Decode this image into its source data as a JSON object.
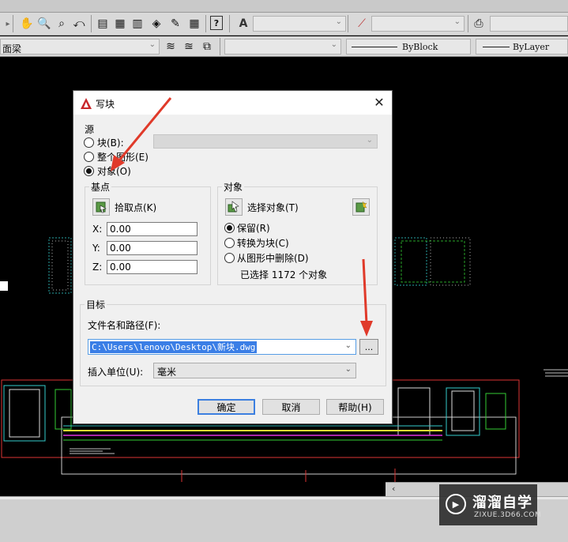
{
  "toolbar": {
    "layer_filter_value": "面梁",
    "linetype_value": "ByBlock",
    "lineweight_value": "ByLayer",
    "icons": [
      "pan-icon",
      "zoom-realtime-icon",
      "zoom-window-icon",
      "zoom-previous-icon",
      "properties-icon",
      "design-center-icon",
      "tool-palettes-icon",
      "sheet-set-icon",
      "markup-icon",
      "calculator-icon",
      "help-icon",
      "text-style-icon",
      "dimension-style-icon",
      "plot-style-icon",
      "layer-manager-icon",
      "layer-state-icon",
      "layer-previous-icon"
    ]
  },
  "dialog": {
    "title": "写块",
    "source": {
      "label": "源",
      "options": [
        {
          "label": "块(B):",
          "checked": false
        },
        {
          "label": "整个图形(E)",
          "checked": false
        },
        {
          "label": "对象(O)",
          "checked": true
        }
      ]
    },
    "base_point": {
      "label": "基点",
      "pick_label": "拾取点(K)",
      "x_label": "X:",
      "y_label": "Y:",
      "z_label": "Z:",
      "x": "0.00",
      "y": "0.00",
      "z": "0.00"
    },
    "objects": {
      "label": "对象",
      "select_label": "选择对象(T)",
      "options": [
        {
          "label": "保留(R)",
          "checked": true
        },
        {
          "label": "转换为块(C)",
          "checked": false
        },
        {
          "label": "从图形中删除(D)",
          "checked": false
        }
      ],
      "selected_text": "已选择 1172 个对象"
    },
    "destination": {
      "label": "目标",
      "path_label": "文件名和路径(F):",
      "path_value": "C:\\Users\\lenovo\\Desktop\\新块.dwg",
      "browse_label": "...",
      "units_label": "插入单位(U):",
      "units_value": "毫米"
    },
    "buttons": {
      "ok": "确定",
      "cancel": "取消",
      "help": "帮助(H)"
    }
  },
  "watermark": {
    "title": "溜溜自学",
    "url": "ZIXUE.3D66.COM"
  },
  "colors": {
    "canvas": "#000000",
    "dialog_bg": "#f0f0f0",
    "accent": "#3c7fe0",
    "annotation_arrow": "#e03a2a"
  }
}
